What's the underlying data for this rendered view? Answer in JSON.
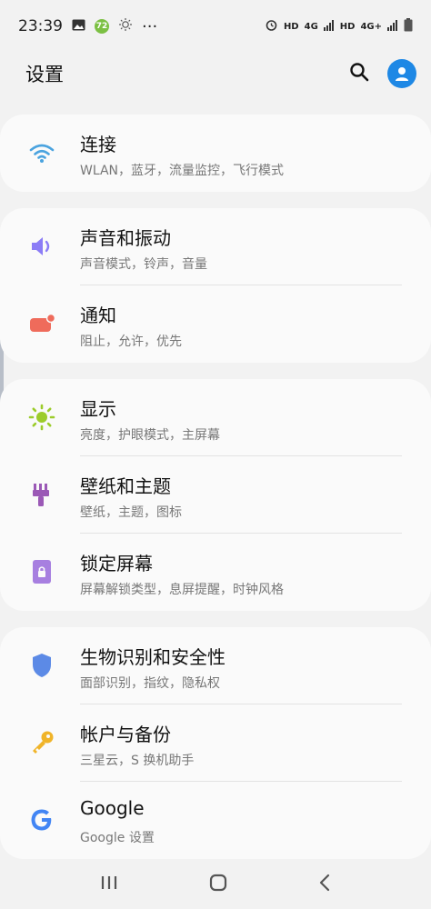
{
  "status": {
    "time": "23:39",
    "badge": "72",
    "dots": "···",
    "hd1": "HD",
    "net1": "4G",
    "hd2": "HD",
    "net2": "4G+"
  },
  "header": {
    "title": "设置"
  },
  "colors": {
    "accent": "#1e88e5",
    "wifi": "#4aa3df",
    "sound": "#8b7cf6",
    "notify": "#ef6b5b",
    "display": "#9ccc2b",
    "wallpaper": "#9b59b6",
    "lock": "#a77fe0",
    "security": "#5c8ae6",
    "account": "#f0b429",
    "google": "#4285f4"
  },
  "groups": [
    {
      "items": [
        {
          "title": "连接",
          "subtitle": "WLAN，蓝牙，流量监控，飞行模式",
          "icon": "wifi-icon"
        }
      ]
    },
    {
      "items": [
        {
          "title": "声音和振动",
          "subtitle": "声音模式，铃声，音量",
          "icon": "volume-icon"
        },
        {
          "title": "通知",
          "subtitle": "阻止，允许，优先",
          "icon": "notification-icon"
        }
      ]
    },
    {
      "items": [
        {
          "title": "显示",
          "subtitle": "亮度，护眼模式，主屏幕",
          "icon": "brightness-icon"
        },
        {
          "title": "壁纸和主题",
          "subtitle": "壁纸，主题，图标",
          "icon": "paintbrush-icon"
        },
        {
          "title": "锁定屏幕",
          "subtitle": "屏幕解锁类型，息屏提醒，时钟风格",
          "icon": "lock-screen-icon"
        }
      ]
    },
    {
      "items": [
        {
          "title": "生物识别和安全性",
          "subtitle": "面部识别，指纹，隐私权",
          "icon": "shield-icon"
        },
        {
          "title": "帐户与备份",
          "subtitle": "三星云，S 换机助手",
          "icon": "key-icon"
        },
        {
          "title": "Google",
          "subtitle": "Google 设置",
          "icon": "google-icon"
        }
      ]
    }
  ]
}
